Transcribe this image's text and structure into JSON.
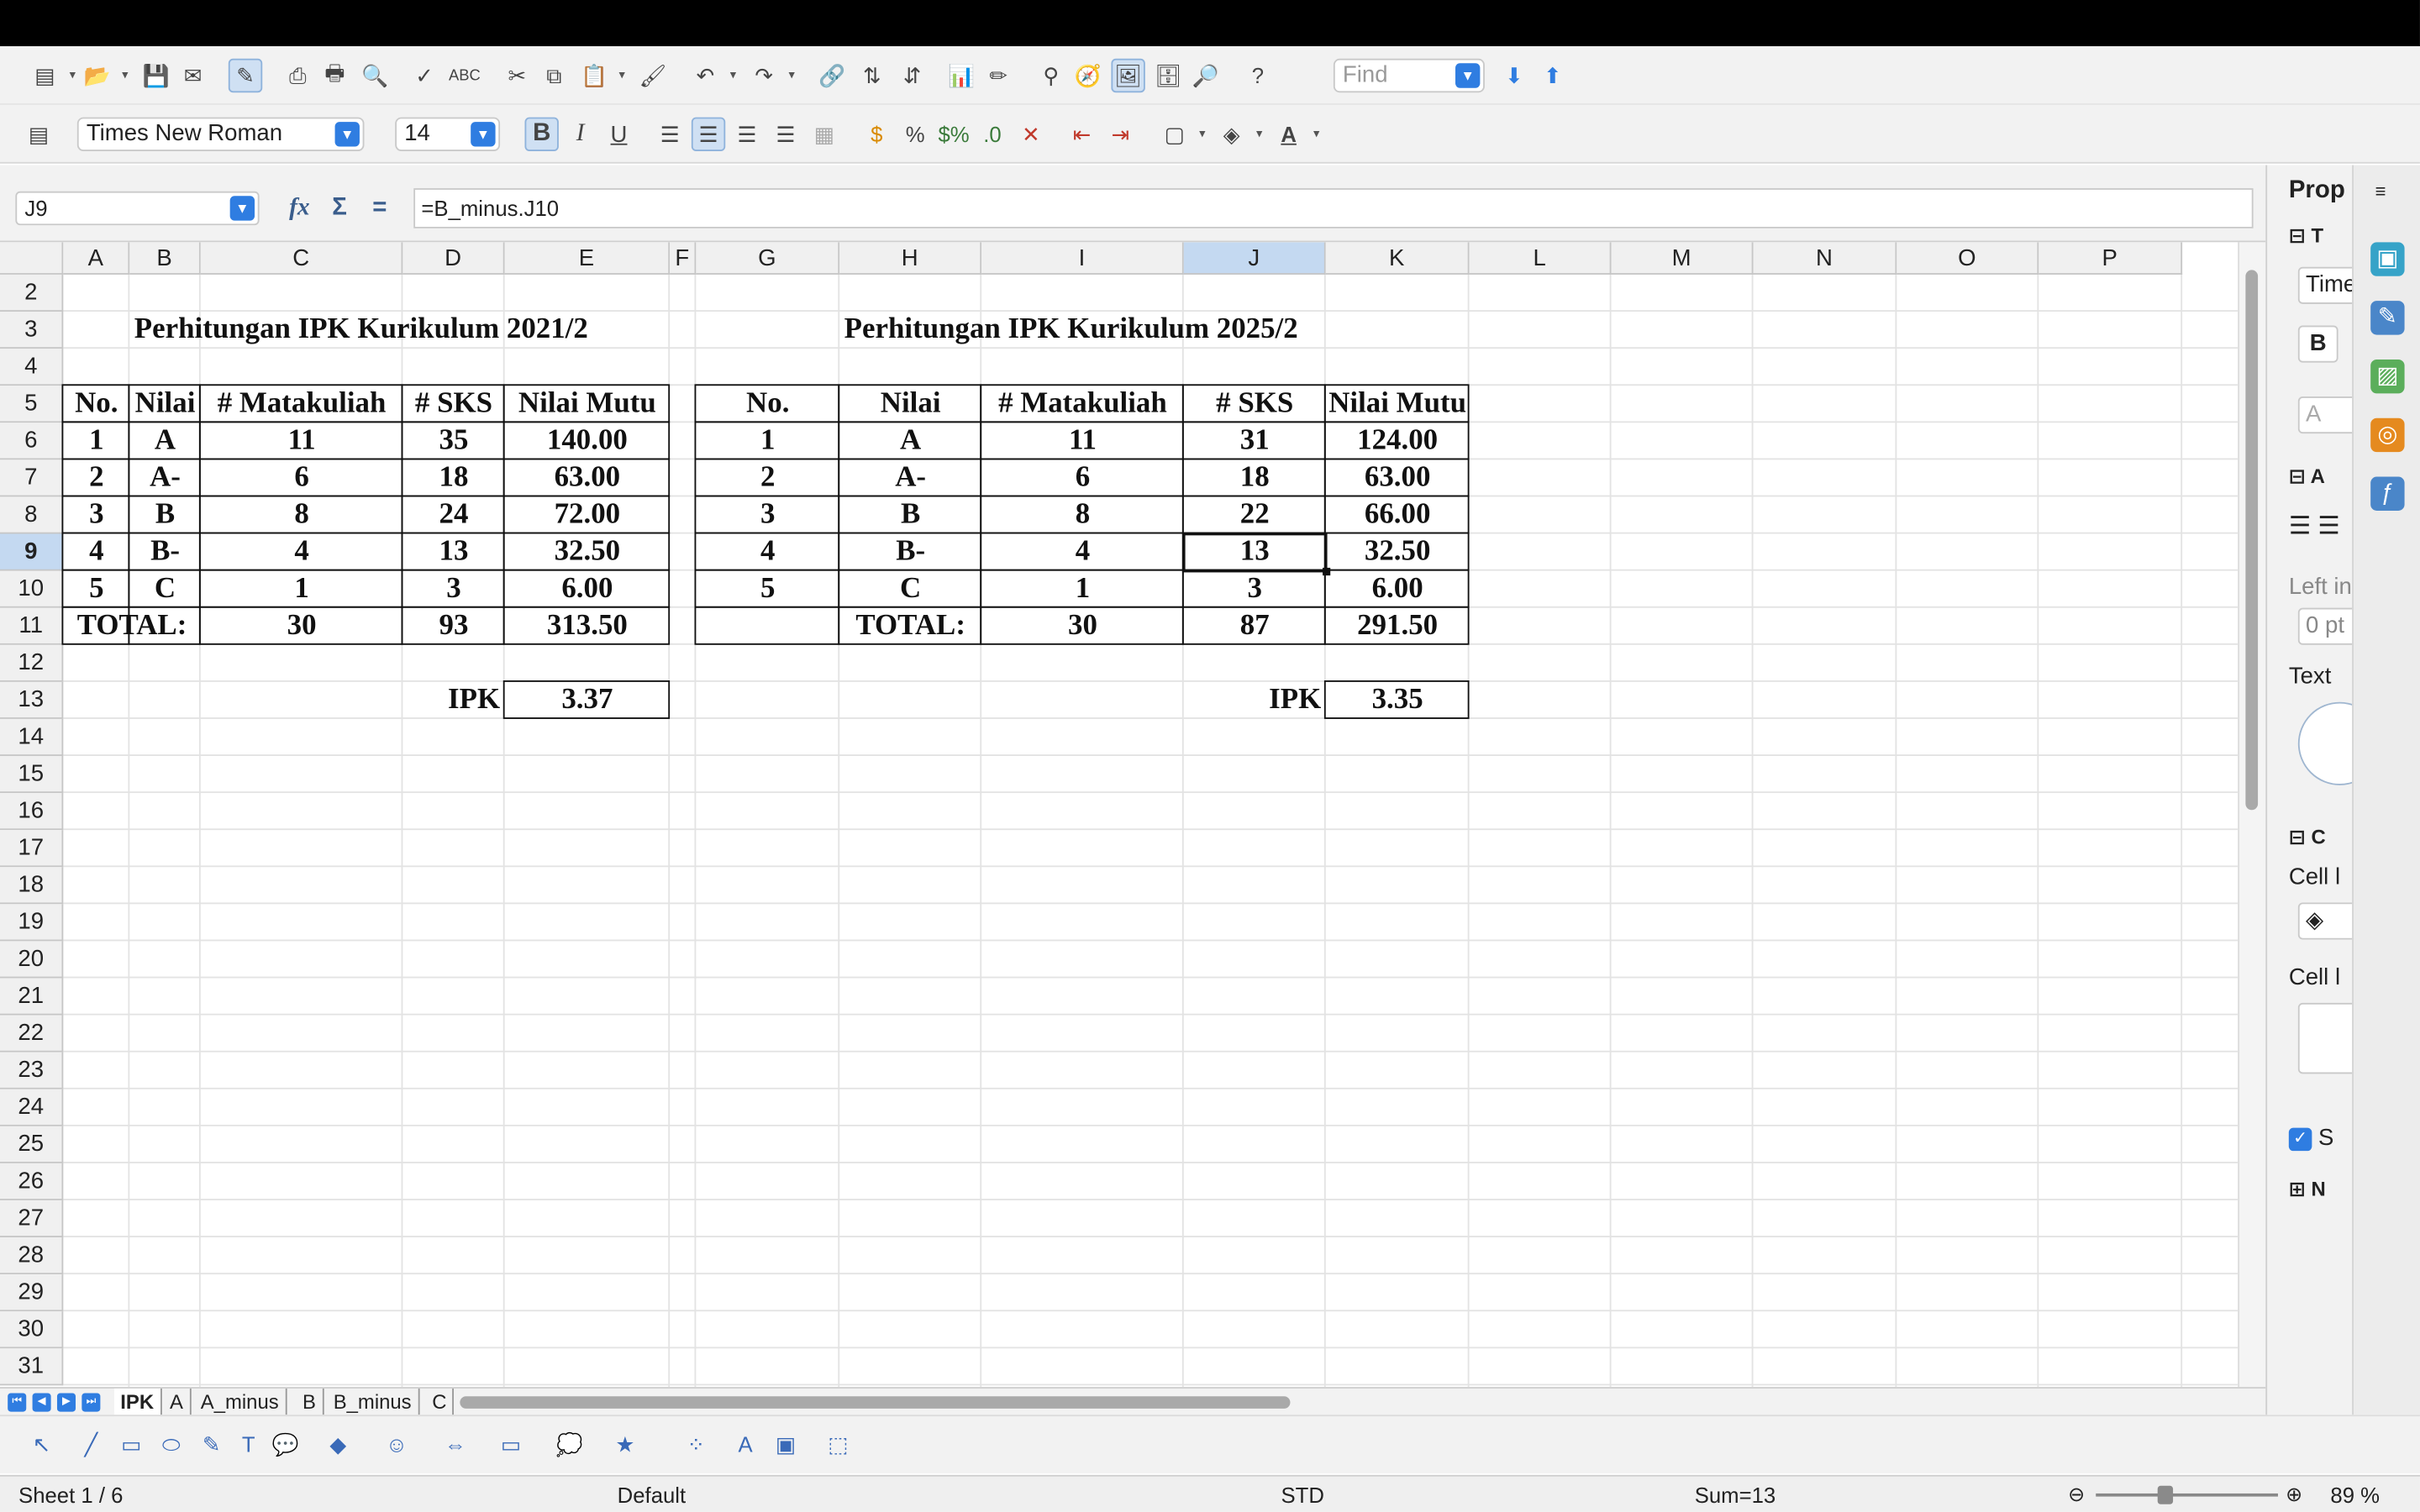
{
  "toolbar": {
    "standard_icons": [
      "new-icon",
      "open-icon",
      "save-icon",
      "email-icon",
      "edit-mode-icon",
      "export-pdf-icon",
      "print-icon",
      "print-preview-icon",
      "spelling-icon",
      "autospell-icon",
      "cut-icon",
      "copy-icon",
      "paste-icon",
      "clone-format-icon",
      "undo-icon",
      "redo-icon",
      "hyperlink-icon",
      "sort-ascending-icon",
      "sort-descending-icon",
      "chart-icon",
      "draw-functions-icon",
      "find-replace-icon",
      "navigator-icon",
      "gallery-icon",
      "data-sources-icon",
      "zoom-icon",
      "help-icon"
    ],
    "find_placeholder": "Find"
  },
  "formatting": {
    "font_name": "Times New Roman",
    "font_size": "14",
    "bold_label": "B",
    "italic_label": "I",
    "underline_label": "U"
  },
  "formula_bar": {
    "cell_ref": "J9",
    "formula": "=B_minus.J10",
    "function_wizard_label": "fx",
    "sum_label": "Σ",
    "equals_label": "="
  },
  "grid": {
    "columns": [
      "A",
      "B",
      "C",
      "D",
      "E",
      "F",
      "G",
      "H",
      "I",
      "J",
      "K",
      "L",
      "M",
      "N",
      "O",
      "P"
    ],
    "selected_column": "J",
    "rows": [
      "2",
      "3",
      "4",
      "5",
      "6",
      "7",
      "8",
      "9",
      "10",
      "11",
      "12",
      "13",
      "14",
      "15",
      "16",
      "17",
      "18",
      "19",
      "20",
      "21",
      "22",
      "23",
      "24",
      "25",
      "26",
      "27",
      "28",
      "29",
      "30",
      "31"
    ],
    "selected_row": "9"
  },
  "table_left": {
    "title": "Perhitungan IPK Kurikulum 2021/2",
    "headers": [
      "No.",
      "Nilai",
      "# Matakuliah",
      "# SKS",
      "Nilai Mutu"
    ],
    "rows": [
      [
        "1",
        "A",
        "11",
        "35",
        "140.00"
      ],
      [
        "2",
        "A-",
        "6",
        "18",
        "63.00"
      ],
      [
        "3",
        "B",
        "8",
        "24",
        "72.00"
      ],
      [
        "4",
        "B-",
        "4",
        "13",
        "32.50"
      ],
      [
        "5",
        "C",
        "1",
        "3",
        "6.00"
      ]
    ],
    "total": [
      "TOTAL:",
      "30",
      "93",
      "313.50"
    ],
    "ipk_label": "IPK",
    "ipk_value": "3.37"
  },
  "table_right": {
    "title": "Perhitungan IPK Kurikulum 2025/2",
    "headers": [
      "No.",
      "Nilai",
      "# Matakuliah",
      "# SKS",
      "Nilai Mutu"
    ],
    "rows": [
      [
        "1",
        "A",
        "11",
        "31",
        "124.00"
      ],
      [
        "2",
        "A-",
        "6",
        "18",
        "63.00"
      ],
      [
        "3",
        "B",
        "8",
        "22",
        "66.00"
      ],
      [
        "4",
        "B-",
        "4",
        "13",
        "32.50"
      ],
      [
        "5",
        "C",
        "1",
        "3",
        "6.00"
      ]
    ],
    "total": [
      "TOTAL:",
      "30",
      "87",
      "291.50"
    ],
    "ipk_label": "IPK",
    "ipk_value": "3.35"
  },
  "sheet_tabs": [
    "IPK",
    "A",
    "A_minus",
    "B",
    "B_minus",
    "C"
  ],
  "active_sheet": "IPK",
  "status": {
    "sheet": "Sheet 1 / 6",
    "page_style": "Default",
    "mode": "STD",
    "sum": "Sum=13",
    "zoom": "89 %",
    "zoom_fraction": 0.38
  },
  "sidebar": {
    "title": "Prop",
    "font_box": "Time",
    "character_section": "T",
    "alignment_section": "A",
    "left_indent_label": "Left in",
    "left_indent_value": "0 pt",
    "text_orientation_label": "Text",
    "cell_appearance_section": "C",
    "cell_background_label": "Cell l",
    "cell_border_label": "Cell l",
    "show_checkbox_label": "S",
    "number_format_section": "N"
  },
  "colors": {
    "accent": "#2f7de1",
    "selection_header": "#c4d9f1",
    "chrome": "#f2f2f2"
  }
}
